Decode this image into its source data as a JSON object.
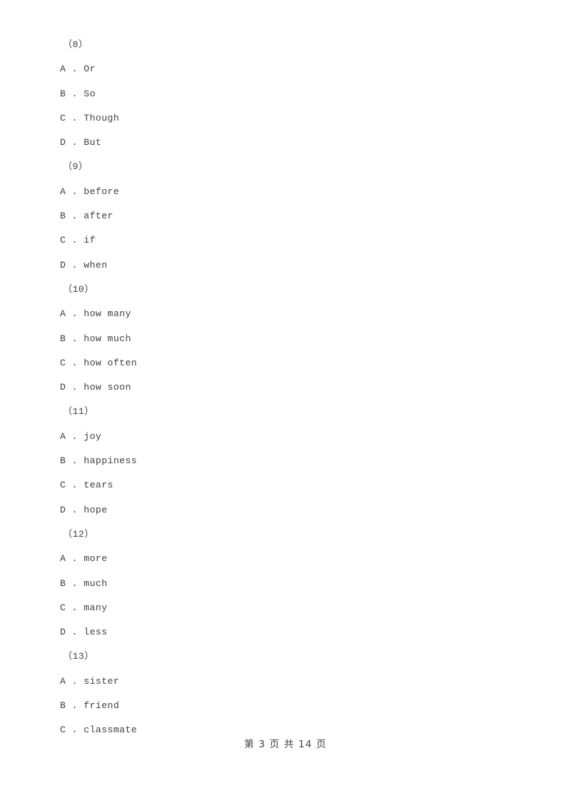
{
  "document": {
    "page_background": "#ffffff",
    "text_color": "#3f3f3f"
  },
  "questions": [
    {
      "number": "（8）",
      "options": [
        {
          "letter": "A",
          "sep": " . ",
          "text": "Or"
        },
        {
          "letter": "B",
          "sep": " . ",
          "text": "So"
        },
        {
          "letter": "C",
          "sep": " . ",
          "text": "Though"
        },
        {
          "letter": "D",
          "sep": " . ",
          "text": "But"
        }
      ]
    },
    {
      "number": "（9）",
      "options": [
        {
          "letter": "A",
          "sep": " . ",
          "text": "before"
        },
        {
          "letter": "B",
          "sep": " . ",
          "text": "after"
        },
        {
          "letter": "C",
          "sep": " . ",
          "text": "if"
        },
        {
          "letter": "D",
          "sep": " . ",
          "text": "when"
        }
      ]
    },
    {
      "number": "（10）",
      "options": [
        {
          "letter": "A",
          "sep": " . ",
          "text": "how many"
        },
        {
          "letter": "B",
          "sep": " . ",
          "text": "how much"
        },
        {
          "letter": "C",
          "sep": " . ",
          "text": "how often"
        },
        {
          "letter": "D",
          "sep": " . ",
          "text": "how soon"
        }
      ]
    },
    {
      "number": "（11）",
      "options": [
        {
          "letter": "A",
          "sep": " . ",
          "text": "joy"
        },
        {
          "letter": "B",
          "sep": " . ",
          "text": "happiness"
        },
        {
          "letter": "C",
          "sep": " . ",
          "text": "tears"
        },
        {
          "letter": "D",
          "sep": " . ",
          "text": "hope"
        }
      ]
    },
    {
      "number": "（12）",
      "options": [
        {
          "letter": "A",
          "sep": " . ",
          "text": "more"
        },
        {
          "letter": "B",
          "sep": " . ",
          "text": "much"
        },
        {
          "letter": "C",
          "sep": " . ",
          "text": "many"
        },
        {
          "letter": "D",
          "sep": " . ",
          "text": "less"
        }
      ]
    },
    {
      "number": "（13）",
      "options": [
        {
          "letter": "A",
          "sep": " . ",
          "text": "sister"
        },
        {
          "letter": "B",
          "sep": " . ",
          "text": "friend"
        },
        {
          "letter": "C",
          "sep": " . ",
          "text": "classmate"
        }
      ]
    }
  ],
  "footer": {
    "text": "第 3 页 共 14 页",
    "current_page": "3",
    "total_pages": "14"
  }
}
